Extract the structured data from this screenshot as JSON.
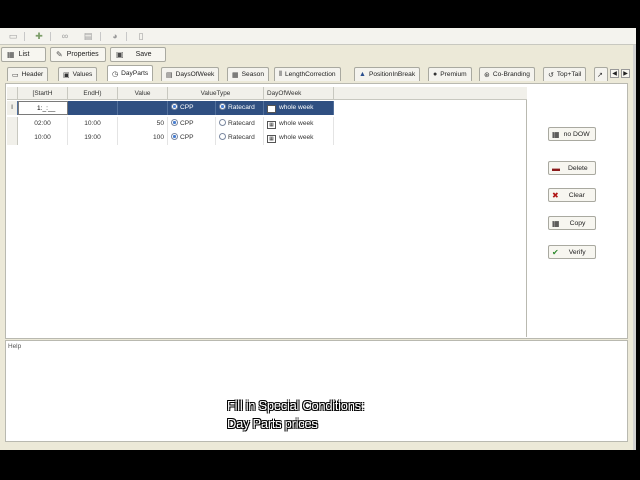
{
  "toolbar": {
    "list_label": "List",
    "properties_label": "Properties",
    "save_label": "Save"
  },
  "tabs": [
    {
      "label": "Header",
      "icon": "header-icon"
    },
    {
      "label": "Values",
      "icon": "values-icon"
    },
    {
      "label": "DayParts",
      "icon": "clock-icon",
      "active": true
    },
    {
      "label": "DaysOfWeek",
      "icon": "calendar-icon"
    },
    {
      "label": "Season",
      "icon": "grid-icon"
    },
    {
      "label": "LengthCorrection",
      "icon": "ruler-icon"
    },
    {
      "label": "PositionInBreak",
      "icon": "position-icon"
    },
    {
      "label": "Premium",
      "icon": "premium-icon"
    },
    {
      "label": "Co-Branding",
      "icon": "cobranding-icon"
    },
    {
      "label": "Top+Tail",
      "icon": "toptail-icon"
    }
  ],
  "grid": {
    "columns": [
      "StartH",
      "EndH",
      "Value",
      "ValueType",
      "DayOfWeek"
    ],
    "edit_value": "1:_:__",
    "row_marker": "I",
    "options": {
      "cpp": "CPP",
      "ratecard": "Ratecard"
    },
    "new_row": {
      "start": "",
      "end": "",
      "value": "",
      "value_type": "CPP",
      "dow": "whole week"
    },
    "rows": [
      {
        "start": "02:00",
        "end": "10:00",
        "value": "50",
        "value_type": "CPP",
        "dow": "whole week"
      },
      {
        "start": "10:00",
        "end": "19:00",
        "value": "100",
        "value_type": "CPP",
        "dow": "whole week"
      }
    ]
  },
  "side_buttons": {
    "no_dow": "no DOW",
    "delete": "Delete",
    "clear": "Clear",
    "copy": "Copy",
    "verify": "Verify"
  },
  "help": {
    "label": "Help"
  },
  "caption": {
    "line1": "Fill in Special Conditions:",
    "line2": "Day Parts prices"
  }
}
